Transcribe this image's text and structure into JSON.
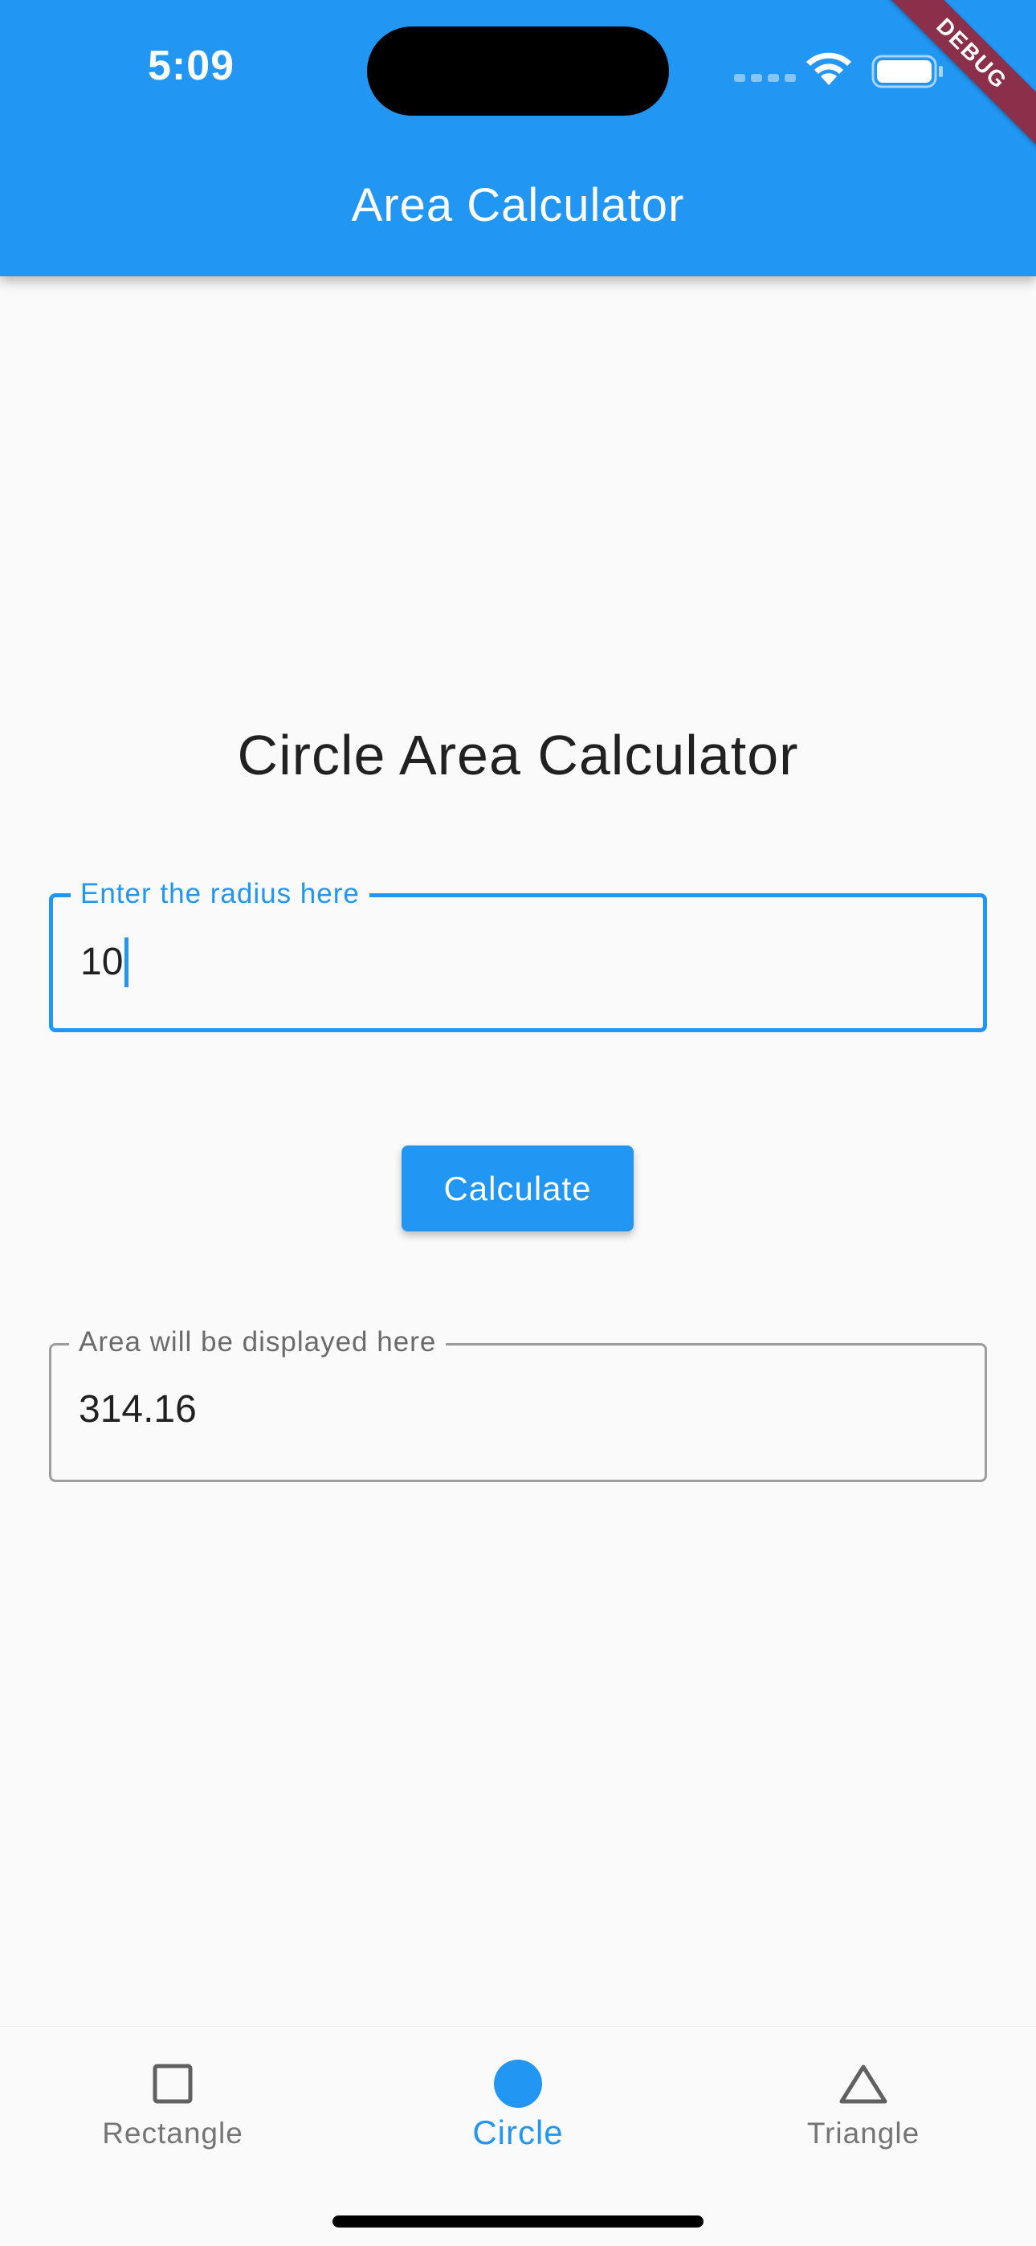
{
  "status_bar": {
    "time": "5:09",
    "debug_label": "DEBUG"
  },
  "app_bar": {
    "title": "Area Calculator",
    "color": "#2196F3"
  },
  "main": {
    "heading": "Circle Area Calculator",
    "radius_input": {
      "label": "Enter the radius here",
      "value": "10"
    },
    "calculate_button": {
      "label": "Calculate"
    },
    "area_output": {
      "label": "Area will be displayed here",
      "value": "314.16"
    }
  },
  "bottom_nav": {
    "items": [
      {
        "label": "Rectangle",
        "icon": "square-outline-icon",
        "selected": false
      },
      {
        "label": "Circle",
        "icon": "circle-filled-icon",
        "selected": true
      },
      {
        "label": "Triangle",
        "icon": "triangle-outline-icon",
        "selected": false
      }
    ],
    "selected_color": "#2196F3",
    "unselected_color": "#757575"
  }
}
